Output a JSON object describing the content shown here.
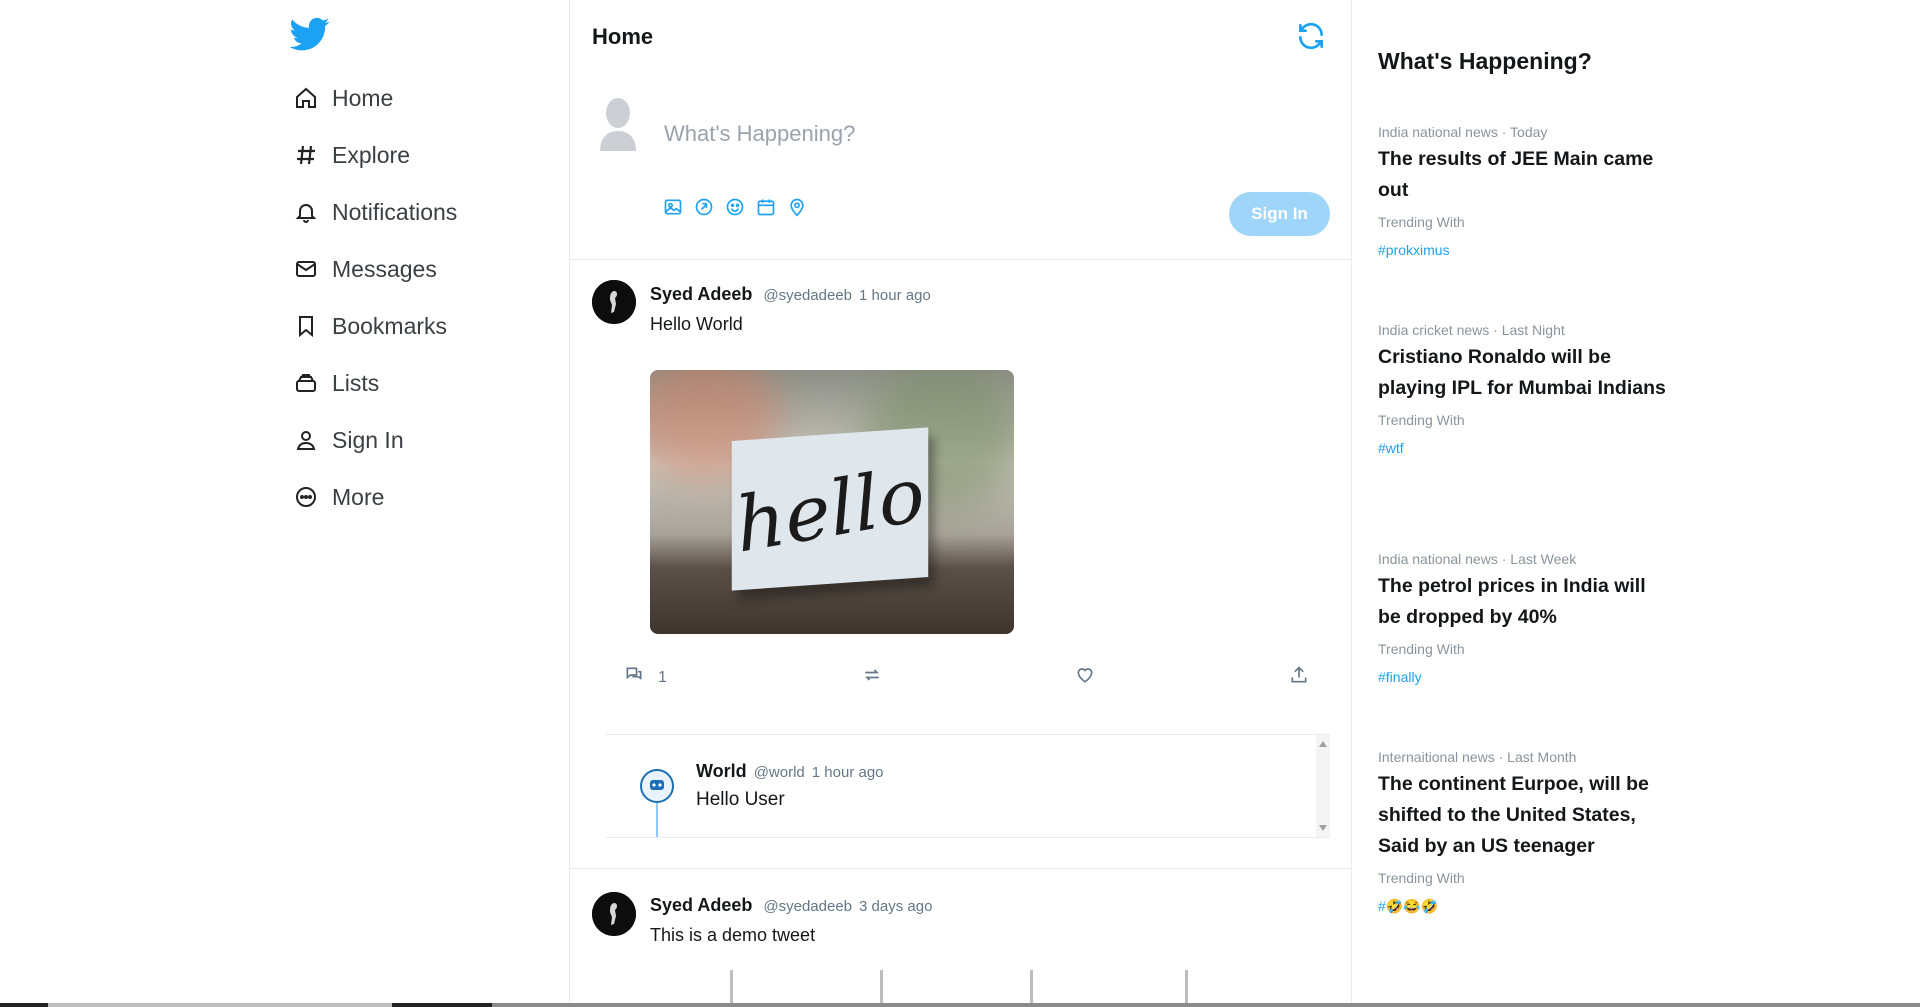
{
  "sidebar": {
    "logo_icon": "twitter-bird-icon",
    "items": [
      {
        "label": "Home",
        "icon": "home-icon"
      },
      {
        "label": "Explore",
        "icon": "hashtag-icon"
      },
      {
        "label": "Notifications",
        "icon": "bell-icon"
      },
      {
        "label": "Messages",
        "icon": "envelope-icon"
      },
      {
        "label": "Bookmarks",
        "icon": "bookmark-icon"
      },
      {
        "label": "Lists",
        "icon": "list-icon"
      },
      {
        "label": "Sign In",
        "icon": "user-icon"
      },
      {
        "label": "More",
        "icon": "more-circle-icon"
      }
    ]
  },
  "feed": {
    "title": "Home",
    "refresh_icon": "refresh-icon"
  },
  "composer": {
    "placeholder": "What's Happening?",
    "tools": [
      "image-icon",
      "gif-icon",
      "emoji-icon",
      "calendar-icon",
      "location-icon"
    ],
    "signin_label": "Sign In"
  },
  "tweets": [
    {
      "name": "Syed Adeeb",
      "handle": "@syedadeeb",
      "time": "1 hour ago",
      "text": "Hello World",
      "image_text": "hello",
      "reply_count": "1",
      "reply": {
        "name": "World",
        "handle": "@world",
        "time": "1 hour ago",
        "text": "Hello User"
      }
    },
    {
      "name": "Syed Adeeb",
      "handle": "@syedadeeb",
      "time": "3 days ago",
      "text": "This is a demo tweet"
    }
  ],
  "trends": {
    "title": "What's Happening?",
    "items": [
      {
        "meta": "India national news · Today",
        "headline": "The results of JEE Main came out",
        "with": "Trending With",
        "tag": "#prokximus"
      },
      {
        "meta": "India cricket news · Last Night",
        "headline": "Cristiano Ronaldo will be playing IPL for Mumbai Indians",
        "with": "Trending With",
        "tag": "#wtf"
      },
      {
        "meta": "India national news · Last Week",
        "headline": "The petrol prices in India will be dropped by 40%",
        "with": "Trending With",
        "tag": "#finally"
      },
      {
        "meta": "Internaitional news · Last Month",
        "headline": "The continent Eurpoe, will be shifted to the United States, Said by an US teenager",
        "with": "Trending With",
        "tag": "#🤣😂🤣"
      }
    ]
  },
  "colors": {
    "accent": "#1da1f2",
    "signin_button": "#9fd5f8",
    "muted_text": "#657786"
  }
}
